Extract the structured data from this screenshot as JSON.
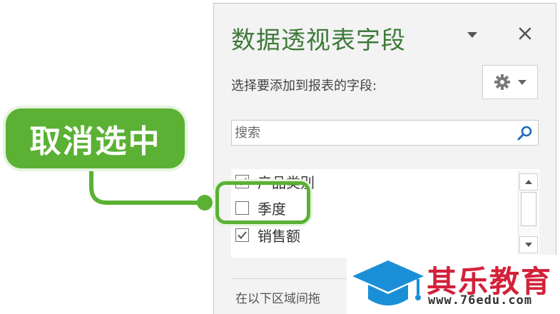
{
  "pane": {
    "title": "数据透视表字段",
    "choose_fields_label": "选择要添加到报表的字段:",
    "search_placeholder": "搜索",
    "fields": [
      {
        "label": "产品类别",
        "checked": true
      },
      {
        "label": "季度",
        "checked": false
      },
      {
        "label": "销售额",
        "checked": true
      }
    ],
    "drag_hint": "在以下区域间拖"
  },
  "callout": {
    "label": "取消选中",
    "color": "#5ab134"
  },
  "watermark": {
    "name": "其乐教育",
    "url": "www.76edu.com",
    "color": "#d3213a"
  },
  "icons": [
    "dropdown-icon",
    "close-icon",
    "gear-icon",
    "search-icon",
    "checkmark-icon",
    "scroll-up-icon",
    "scroll-down-icon",
    "graduation-cap-logo"
  ],
  "colors": {
    "title_green": "#3f7a3a",
    "accent_green": "#5ab134",
    "search_icon_blue": "#1f6cc0"
  }
}
